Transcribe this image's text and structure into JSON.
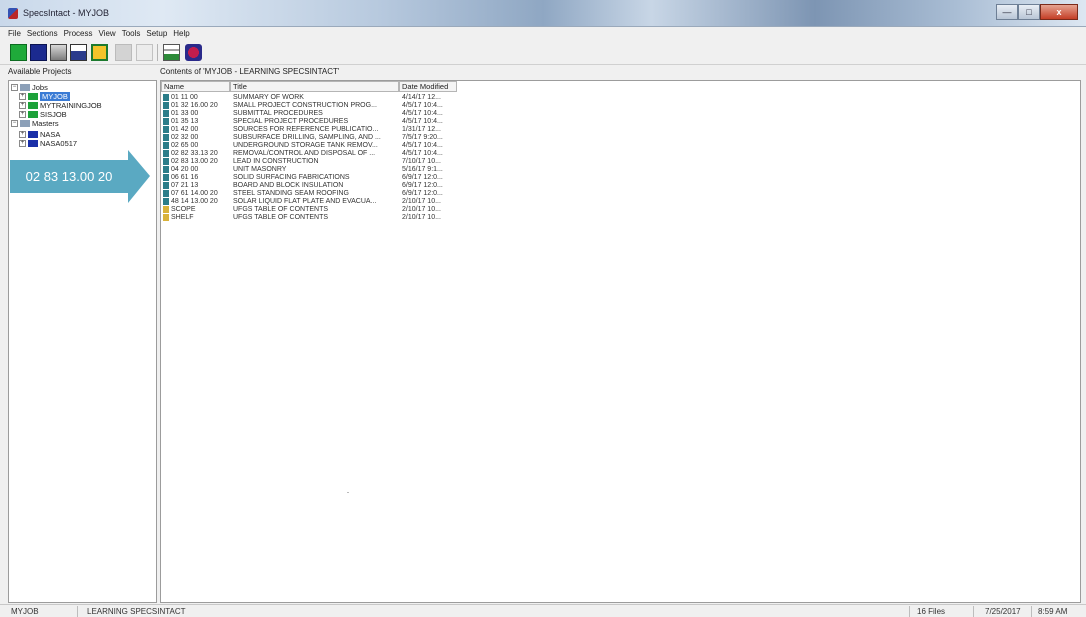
{
  "window": {
    "title": "SpecsIntact - MYJOB",
    "min_glyph": "—",
    "max_glyph": "□",
    "close_glyph": "x"
  },
  "menu": [
    "File",
    "Sections",
    "Process",
    "View",
    "Tools",
    "Setup",
    "Help"
  ],
  "toolbar": {
    "icons": [
      "new-job-icon",
      "open-folder-icon",
      "print-icon",
      "properties-icon",
      "project-folder-icon",
      "disabled-icon",
      "disabled-doc-icon",
      "tree-view-icon",
      "book-icon"
    ]
  },
  "left_pane": {
    "header": "Available Projects",
    "tree": [
      {
        "label": "Jobs",
        "expander": "−",
        "level": 0,
        "folder": "gray"
      },
      {
        "label": "MYJOB",
        "expander": "+",
        "level": 1,
        "folder": "green",
        "selected": true
      },
      {
        "label": "MYTRAININGJOB",
        "expander": "+",
        "level": 1,
        "folder": "green"
      },
      {
        "label": "SISJOB",
        "expander": "+",
        "level": 1,
        "folder": "green"
      },
      {
        "label": "Masters",
        "expander": "−",
        "level": 0,
        "folder": "gray"
      },
      {
        "label": "NASA",
        "expander": "+",
        "level": 1,
        "folder": "blue"
      },
      {
        "label": "NASA0517",
        "expander": "+",
        "level": 1,
        "folder": "blue"
      }
    ]
  },
  "callout": {
    "text": "02 83 13.00 20"
  },
  "right_pane": {
    "header": "Contents of 'MYJOB - LEARNING SPECSINTACT'",
    "columns": [
      "Name",
      "Title",
      "Date Modified"
    ],
    "rows": [
      {
        "name": "01 11 00",
        "title": "SUMMARY OF WORK",
        "date": "4/14/17 12...",
        "icon": "teal"
      },
      {
        "name": "01 32 16.00 20",
        "title": "SMALL PROJECT CONSTRUCTION PROG...",
        "date": "4/5/17 10:4...",
        "icon": "teal"
      },
      {
        "name": "01 33 00",
        "title": "SUBMITTAL PROCEDURES",
        "date": "4/5/17 10:4...",
        "icon": "teal"
      },
      {
        "name": "01 35 13",
        "title": "SPECIAL PROJECT PROCEDURES",
        "date": "4/5/17 10:4...",
        "icon": "teal"
      },
      {
        "name": "01 42 00",
        "title": "SOURCES FOR REFERENCE PUBLICATIO...",
        "date": "1/31/17 12...",
        "icon": "teal"
      },
      {
        "name": "02 32 00",
        "title": "SUBSURFACE DRILLING, SAMPLING, AND ...",
        "date": "7/5/17 9:20...",
        "icon": "teal"
      },
      {
        "name": "02 65 00",
        "title": "UNDERGROUND STORAGE TANK REMOV...",
        "date": "4/5/17 10:4...",
        "icon": "teal"
      },
      {
        "name": "02 82 33.13 20",
        "title": "REMOVAL/CONTROL AND DISPOSAL OF ...",
        "date": "4/5/17 10:4...",
        "icon": "teal"
      },
      {
        "name": "02 83 13.00 20",
        "title": "LEAD IN CONSTRUCTION",
        "date": "7/10/17 10...",
        "icon": "teal"
      },
      {
        "name": "04 20 00",
        "title": "UNIT MASONRY",
        "date": "5/16/17 9:1...",
        "icon": "teal"
      },
      {
        "name": "06 61 16",
        "title": "SOLID SURFACING FABRICATIONS",
        "date": "6/9/17 12:0...",
        "icon": "teal"
      },
      {
        "name": "07 21 13",
        "title": "BOARD AND BLOCK INSULATION",
        "date": "6/9/17 12:0...",
        "icon": "teal"
      },
      {
        "name": "07 61 14.00 20",
        "title": "STEEL STANDING SEAM ROOFING",
        "date": "6/9/17 12:0...",
        "icon": "teal"
      },
      {
        "name": "48 14 13.00 20",
        "title": "SOLAR LIQUID FLAT PLATE AND EVACUA...",
        "date": "2/10/17 10...",
        "icon": "teal"
      },
      {
        "name": "SCOPE",
        "title": "UFGS TABLE OF CONTENTS",
        "date": "2/10/17 10...",
        "icon": "yellow"
      },
      {
        "name": "SHELF",
        "title": "UFGS TABLE OF CONTENTS",
        "date": "2/10/17 10...",
        "icon": "yellow"
      }
    ]
  },
  "status_bar": {
    "job": "MYJOB",
    "description": "LEARNING SPECSINTACT",
    "file_count": "16 Files",
    "date": "7/25/2017",
    "time": "8:59 AM"
  },
  "colors": {
    "selection": "#3a7bd5",
    "callout": "#5aa9c2",
    "job_folder": "#1da23a",
    "master_folder": "#1a2fa8"
  }
}
